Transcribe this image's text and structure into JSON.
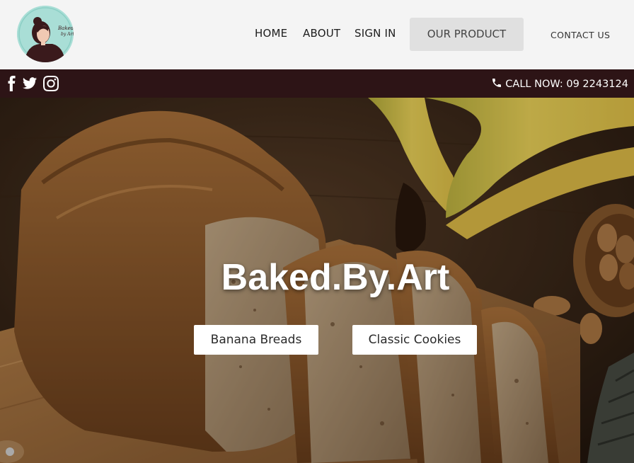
{
  "brand": {
    "logo_icon": "baker-portrait-logo"
  },
  "nav": {
    "home": "HOME",
    "about": "ABOUT",
    "signin": "SIGN IN",
    "product": "OUR PRODUCT",
    "contact": "CONTACT US"
  },
  "infobar": {
    "social_icons": [
      "facebook-icon",
      "twitter-icon",
      "instagram-icon"
    ],
    "call_text": "CALL NOW: 09 2243124",
    "colors": {
      "bar": "#2d1416",
      "text": "#ffffff"
    }
  },
  "hero": {
    "title": "Baked.By.Art",
    "buttons": [
      "Banana Breads",
      "Classic Cookies"
    ]
  },
  "colors": {
    "nav_bg": "#f4f4f4",
    "product_btn_bg": "#e0e0e0",
    "logo_bg": "#a9ded6"
  }
}
